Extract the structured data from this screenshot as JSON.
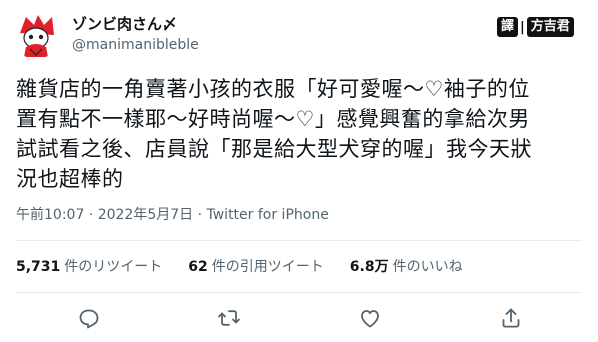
{
  "user": {
    "display_name": "ゾンビ肉さん〆",
    "handle": "@manimanibleble"
  },
  "translator_badge": {
    "left": "譯",
    "separator": "|",
    "right": "方吉君"
  },
  "tweet": {
    "lines": [
      "雜貨店的一角賣著小孩的衣服「好可愛喔～♡袖子的位",
      "置有點不一樣耶～好時尚喔～♡」感覺興奮的拿給次男",
      "試試看之後、店員說「那是給大型犬穿的喔」我今天狀",
      "況也超棒的"
    ],
    "meta": "午前10:07 · 2022年5月7日 · Twitter for iPhone"
  },
  "stats": {
    "retweets": {
      "count": "5,731",
      "label": "件のリツイート"
    },
    "quotes": {
      "count": "62",
      "label": "件の引用ツイート"
    },
    "likes": {
      "count": "6.8万",
      "label": "件のいいね"
    }
  },
  "actions": {
    "icons": [
      "reply-icon",
      "retweet-icon",
      "like-icon",
      "share-icon"
    ]
  },
  "colors": {
    "text": "#0f1419",
    "muted": "#536471",
    "divider": "#e6ecf0",
    "avatar_accent": "#e0202a"
  }
}
